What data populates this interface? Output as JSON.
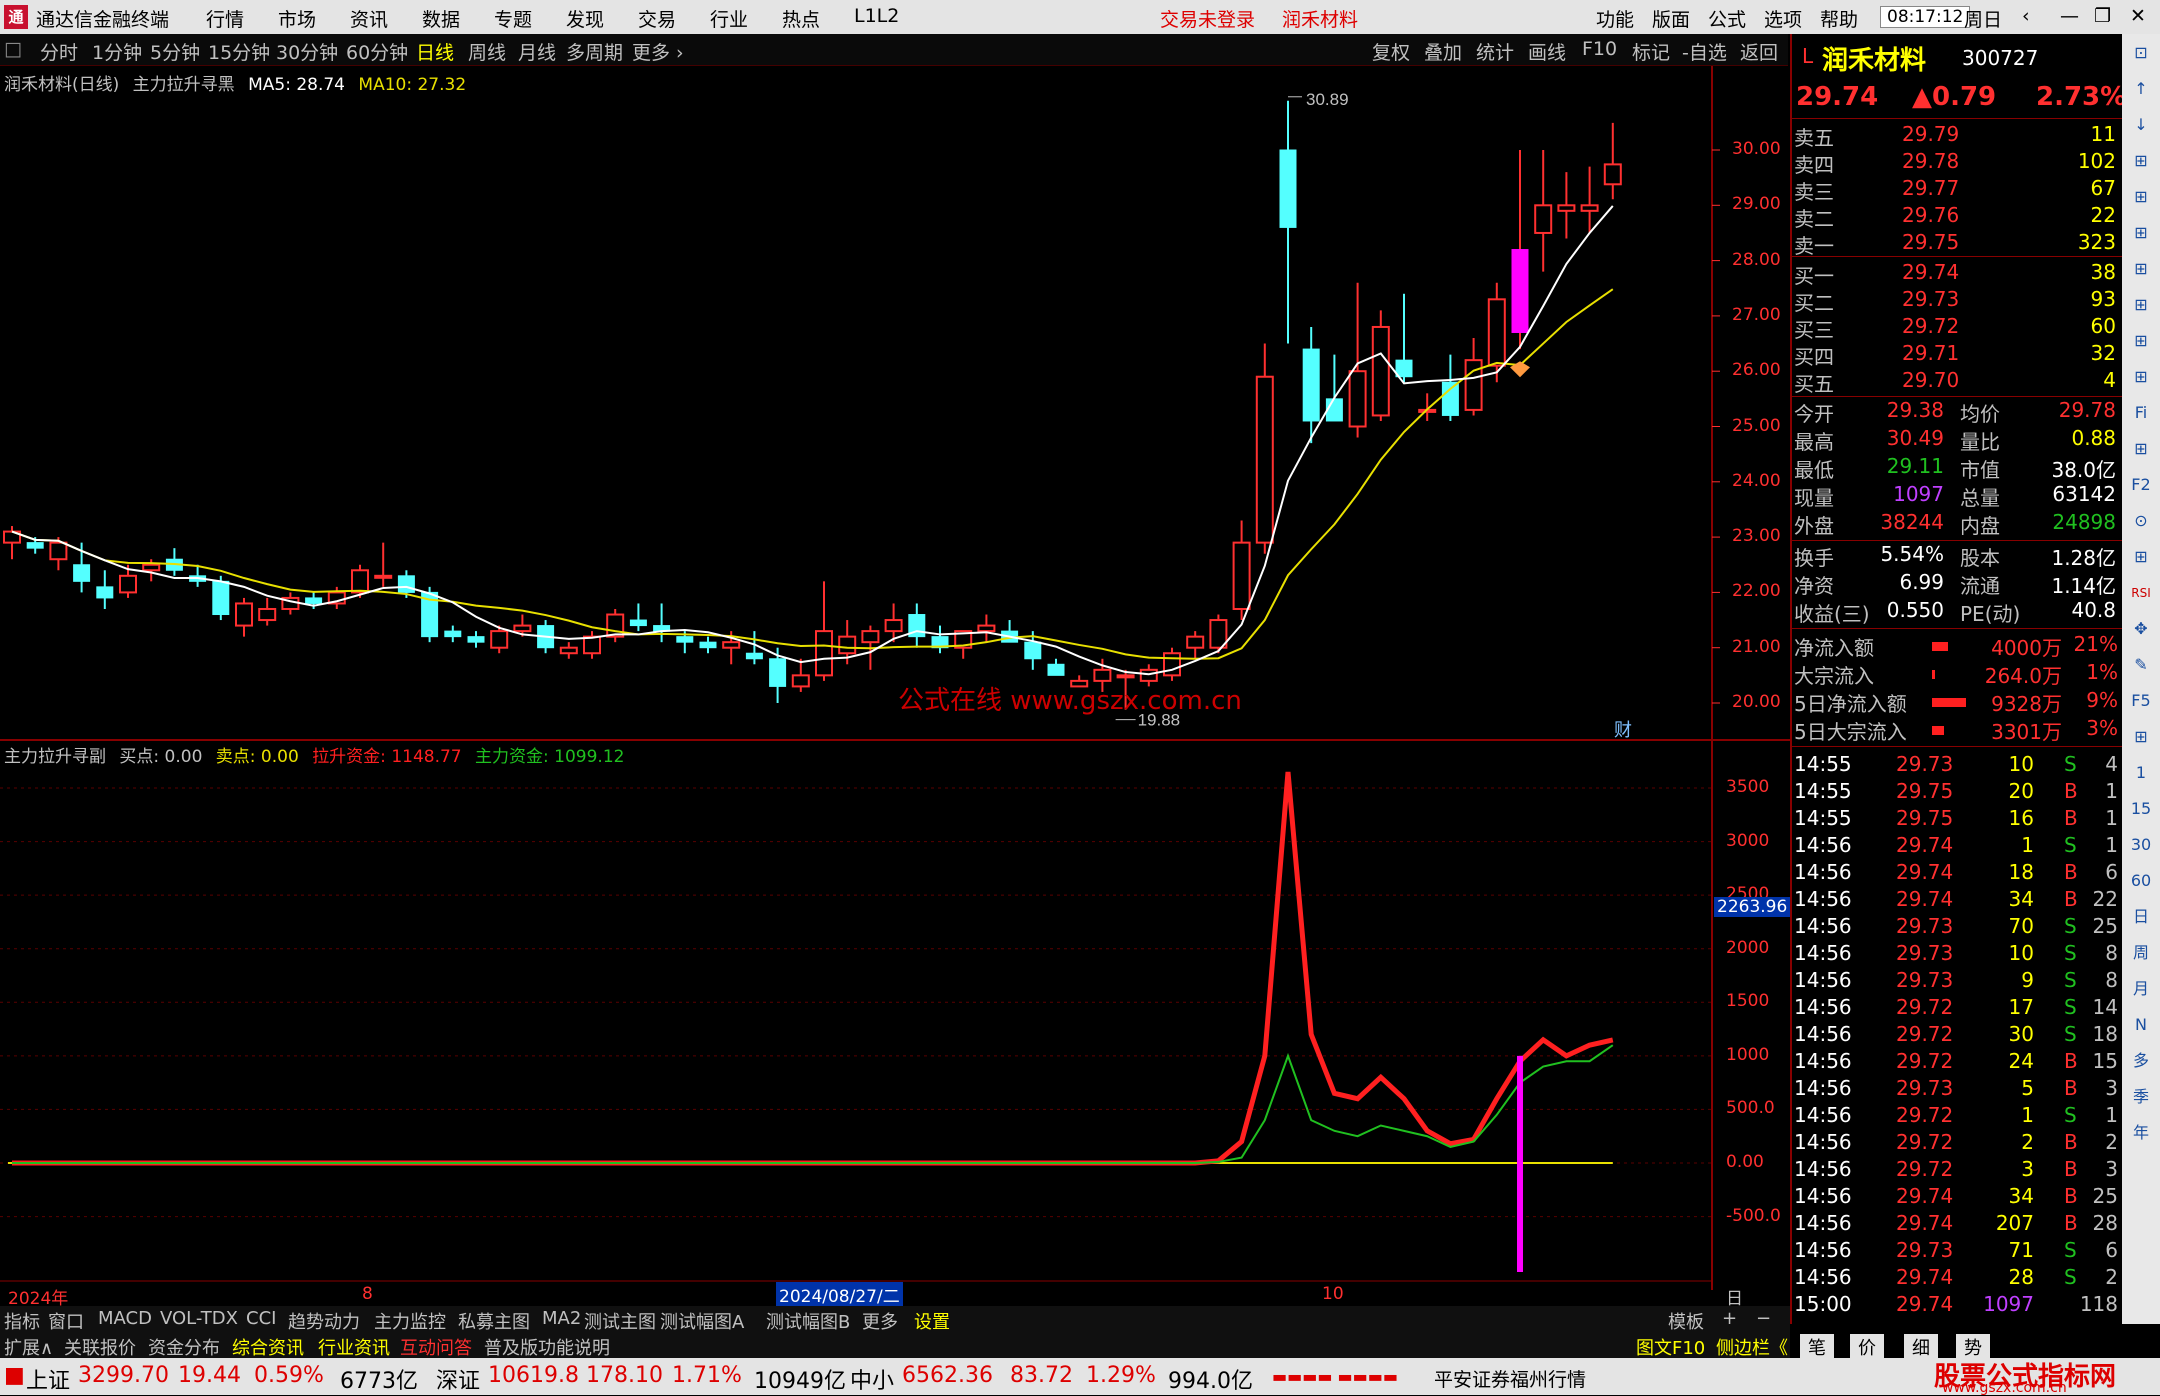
{
  "title_bar": {
    "app_name": "通达信金融终端",
    "menus": [
      "行情",
      "市场",
      "资讯",
      "数据",
      "专题",
      "发现",
      "交易",
      "行业",
      "热点",
      "L1L2"
    ],
    "trade_status": "交易未登录",
    "stock_title": "润禾材料",
    "right_menus": [
      "功能",
      "版面",
      "公式",
      "选项",
      "帮助"
    ],
    "clock": "08:17:12",
    "weekday": "周日",
    "window_icons": [
      "‹",
      "—",
      "❐",
      "✕"
    ]
  },
  "period_bar": {
    "items": [
      "分时",
      "1分钟",
      "5分钟",
      "15分钟",
      "30分钟",
      "60分钟",
      "日线",
      "周线",
      "月线",
      "多周期",
      "更多 ›"
    ],
    "active": "日线",
    "right_items": [
      "复权",
      "叠加",
      "统计",
      "画线",
      "F10",
      "标记",
      "-自选",
      "返回"
    ]
  },
  "main_chart": {
    "legend_name": "润禾材料(日线)",
    "indicator": "主力拉升寻黑",
    "ma5_label": "MA5: 28.74",
    "ma10_label": "MA10: 27.32",
    "high_label": "30.89",
    "low_label": "19.88",
    "watermark": "公式在线  www.gszx.com.cn",
    "fin_badge": "财",
    "y_ticks": [
      "30.00",
      "29.00",
      "28.00",
      "27.00",
      "26.00",
      "25.00",
      "24.00",
      "23.00",
      "22.00",
      "21.00",
      "20.00"
    ]
  },
  "sub_chart": {
    "legend_name": "主力拉升寻副",
    "buy_label": "买点: 0.00",
    "sell_label": "卖点: 0.00",
    "pull_label": "拉升资金: 1148.77",
    "main_label": "主力资金: 1099.12",
    "cursor_value": "2263.96",
    "y_ticks": [
      "3500",
      "3000",
      "2500",
      "2000",
      "1500",
      "1000",
      "500.0",
      "0.00",
      "-500.0"
    ]
  },
  "x_axis": {
    "labels": [
      "2024年",
      "8",
      "2024/08/27/二",
      "10"
    ],
    "period": "日线"
  },
  "chart_data": [
    {
      "type": "candlestick",
      "title": "润禾材料(日线)",
      "y_range": [
        19.8,
        31.0
      ],
      "series": [
        {
          "name": "K",
          "ohlc": [
            [
              22.9,
              23.2,
              22.6,
              23.1
            ],
            [
              22.9,
              23.0,
              22.7,
              22.8
            ],
            [
              22.6,
              23.0,
              22.4,
              22.9
            ],
            [
              22.5,
              22.9,
              22.0,
              22.2
            ],
            [
              22.1,
              22.4,
              21.7,
              21.9
            ],
            [
              22.0,
              22.5,
              21.9,
              22.3
            ],
            [
              22.4,
              22.6,
              22.2,
              22.5
            ],
            [
              22.6,
              22.8,
              22.3,
              22.4
            ],
            [
              22.3,
              22.5,
              22.1,
              22.2
            ],
            [
              22.2,
              22.3,
              21.5,
              21.6
            ],
            [
              21.4,
              21.9,
              21.2,
              21.8
            ],
            [
              21.5,
              21.9,
              21.4,
              21.7
            ],
            [
              21.7,
              22.0,
              21.6,
              21.9
            ],
            [
              21.9,
              22.0,
              21.7,
              21.8
            ],
            [
              21.8,
              22.1,
              21.7,
              22.0
            ],
            [
              22.0,
              22.5,
              21.9,
              22.4
            ],
            [
              22.3,
              22.9,
              22.1,
              22.3
            ],
            [
              22.3,
              22.4,
              21.9,
              22.0
            ],
            [
              22.0,
              22.1,
              21.1,
              21.2
            ],
            [
              21.3,
              21.4,
              21.1,
              21.2
            ],
            [
              21.2,
              21.3,
              21.0,
              21.1
            ],
            [
              21.0,
              21.4,
              20.9,
              21.3
            ],
            [
              21.3,
              21.6,
              21.2,
              21.4
            ],
            [
              21.4,
              21.5,
              20.9,
              21.0
            ],
            [
              20.9,
              21.1,
              20.8,
              21.0
            ],
            [
              20.9,
              21.3,
              20.8,
              21.2
            ],
            [
              21.2,
              21.7,
              21.1,
              21.6
            ],
            [
              21.5,
              21.8,
              21.3,
              21.4
            ],
            [
              21.4,
              21.8,
              21.1,
              21.3
            ],
            [
              21.2,
              21.3,
              20.9,
              21.1
            ],
            [
              21.1,
              21.2,
              20.9,
              21.0
            ],
            [
              21.0,
              21.3,
              20.7,
              21.1
            ],
            [
              20.9,
              21.3,
              20.7,
              20.8
            ],
            [
              20.8,
              21.0,
              20.0,
              20.3
            ],
            [
              20.3,
              20.8,
              20.2,
              20.5
            ],
            [
              20.5,
              22.2,
              20.4,
              21.3
            ],
            [
              20.9,
              21.5,
              20.7,
              21.2
            ],
            [
              21.1,
              21.4,
              20.6,
              21.3
            ],
            [
              21.3,
              21.8,
              21.1,
              21.5
            ],
            [
              21.6,
              21.8,
              21.0,
              21.2
            ],
            [
              21.2,
              21.4,
              20.9,
              21.0
            ],
            [
              21.0,
              21.3,
              20.8,
              21.3
            ],
            [
              21.3,
              21.6,
              21.1,
              21.4
            ],
            [
              21.3,
              21.5,
              21.1,
              21.1
            ],
            [
              21.1,
              21.3,
              20.6,
              20.8
            ],
            [
              20.7,
              20.8,
              20.5,
              20.5
            ],
            [
              20.3,
              20.5,
              20.3,
              20.4
            ],
            [
              20.4,
              20.8,
              20.2,
              20.6
            ],
            [
              20.5,
              20.6,
              19.88,
              20.5
            ],
            [
              20.4,
              20.7,
              20.3,
              20.6
            ],
            [
              20.5,
              21.0,
              20.4,
              20.9
            ],
            [
              21.0,
              21.3,
              20.8,
              21.2
            ],
            [
              21.0,
              21.6,
              20.9,
              21.5
            ],
            [
              21.7,
              23.3,
              21.5,
              22.9
            ],
            [
              22.9,
              26.5,
              22.7,
              25.9
            ],
            [
              30.0,
              30.89,
              26.5,
              28.6
            ],
            [
              26.4,
              26.8,
              24.7,
              25.1
            ],
            [
              25.5,
              26.3,
              25.1,
              25.1
            ],
            [
              25.0,
              27.6,
              24.8,
              26.0
            ],
            [
              25.2,
              27.1,
              25.1,
              26.8
            ],
            [
              26.2,
              27.4,
              25.8,
              25.9
            ],
            [
              25.3,
              25.6,
              25.1,
              25.3
            ],
            [
              25.8,
              26.3,
              25.1,
              25.2
            ],
            [
              25.3,
              26.6,
              25.2,
              26.2
            ],
            [
              26.1,
              27.6,
              25.8,
              27.3
            ],
            [
              26.7,
              30.0,
              26.4,
              28.2
            ],
            [
              28.5,
              30.0,
              27.8,
              29.0
            ],
            [
              28.9,
              29.6,
              28.4,
              29.0
            ],
            [
              28.9,
              29.7,
              28.5,
              29.0
            ],
            [
              29.38,
              30.49,
              29.11,
              29.74
            ]
          ]
        }
      ]
    },
    {
      "type": "line",
      "title": "主力拉升寻副",
      "y_range": [
        -800,
        3800
      ],
      "series": [
        {
          "name": "拉升资金",
          "color": "#ff2020",
          "values": [
            0,
            0,
            0,
            0,
            0,
            0,
            0,
            0,
            0,
            0,
            0,
            0,
            0,
            0,
            0,
            0,
            0,
            0,
            0,
            0,
            0,
            0,
            0,
            0,
            0,
            0,
            0,
            0,
            0,
            0,
            0,
            0,
            0,
            0,
            0,
            0,
            0,
            0,
            0,
            0,
            0,
            0,
            0,
            0,
            0,
            0,
            0,
            0,
            0,
            0,
            0,
            0,
            20,
            200,
            1000,
            3650,
            1200,
            650,
            600,
            800,
            600,
            300,
            180,
            220,
            600,
            950,
            1150,
            1000,
            1100,
            1148.77
          ]
        },
        {
          "name": "主力资金",
          "color": "#20c020",
          "values": [
            0,
            0,
            0,
            0,
            0,
            0,
            0,
            0,
            0,
            0,
            0,
            0,
            0,
            0,
            0,
            0,
            0,
            0,
            0,
            0,
            0,
            0,
            0,
            0,
            0,
            0,
            0,
            0,
            0,
            0,
            0,
            0,
            0,
            0,
            0,
            0,
            0,
            0,
            0,
            0,
            0,
            0,
            0,
            0,
            0,
            0,
            0,
            0,
            0,
            0,
            0,
            0,
            10,
            50,
            400,
            1000,
            400,
            300,
            250,
            350,
            300,
            250,
            150,
            200,
            450,
            750,
            900,
            950,
            950,
            1099.12
          ]
        }
      ]
    }
  ],
  "quote": {
    "name": "润禾材料",
    "code": "300727",
    "price": "29.74",
    "change": "▲0.79",
    "change_pct": "2.73%",
    "asks": [
      [
        "卖五",
        "29.79",
        "11"
      ],
      [
        "卖四",
        "29.78",
        "102"
      ],
      [
        "卖三",
        "29.77",
        "67"
      ],
      [
        "卖二",
        "29.76",
        "22"
      ],
      [
        "卖一",
        "29.75",
        "323"
      ]
    ],
    "bids": [
      [
        "买一",
        "29.74",
        "38"
      ],
      [
        "买二",
        "29.73",
        "93"
      ],
      [
        "买三",
        "29.72",
        "60"
      ],
      [
        "买四",
        "29.71",
        "32"
      ],
      [
        "买五",
        "29.70",
        "4"
      ]
    ],
    "stats": [
      [
        "今开",
        "29.38",
        "均价",
        "29.78"
      ],
      [
        "最高",
        "30.49",
        "量比",
        "0.88"
      ],
      [
        "最低",
        "29.11",
        "市值",
        "38.0亿"
      ],
      [
        "现量",
        "1097",
        "总量",
        "63142"
      ],
      [
        "外盘",
        "38244",
        "内盘",
        "24898"
      ]
    ],
    "fin": [
      [
        "换手",
        "5.54%",
        "股本",
        "1.28亿"
      ],
      [
        "净资",
        "6.99",
        "流通",
        "1.14亿"
      ],
      [
        "收益(三)",
        "0.550",
        "PE(动)",
        "40.8"
      ]
    ],
    "flows": [
      [
        "净流入额",
        "4000万",
        "21%"
      ],
      [
        "大宗流入",
        "264.0万",
        "1%"
      ],
      [
        "5日净流入额",
        "9328万",
        "9%"
      ],
      [
        "5日大宗流入",
        "3301万",
        "3%"
      ]
    ],
    "ticks": [
      [
        "14:55",
        "29.73",
        "10",
        "S",
        "4"
      ],
      [
        "14:55",
        "29.75",
        "20",
        "B",
        "1"
      ],
      [
        "14:55",
        "29.75",
        "16",
        "B",
        "1"
      ],
      [
        "14:56",
        "29.74",
        "1",
        "S",
        "1"
      ],
      [
        "14:56",
        "29.74",
        "18",
        "B",
        "6"
      ],
      [
        "14:56",
        "29.74",
        "34",
        "B",
        "22"
      ],
      [
        "14:56",
        "29.73",
        "70",
        "S",
        "25"
      ],
      [
        "14:56",
        "29.73",
        "10",
        "S",
        "8"
      ],
      [
        "14:56",
        "29.73",
        "9",
        "S",
        "8"
      ],
      [
        "14:56",
        "29.72",
        "17",
        "S",
        "14"
      ],
      [
        "14:56",
        "29.72",
        "30",
        "S",
        "18"
      ],
      [
        "14:56",
        "29.72",
        "24",
        "B",
        "15"
      ],
      [
        "14:56",
        "29.73",
        "5",
        "B",
        "3"
      ],
      [
        "14:56",
        "29.72",
        "1",
        "S",
        "1"
      ],
      [
        "14:56",
        "29.72",
        "2",
        "B",
        "2"
      ],
      [
        "14:56",
        "29.72",
        "3",
        "B",
        "3"
      ],
      [
        "14:56",
        "29.74",
        "34",
        "B",
        "25"
      ],
      [
        "14:56",
        "29.74",
        "207",
        "B",
        "28"
      ],
      [
        "14:56",
        "29.73",
        "71",
        "S",
        "6"
      ],
      [
        "14:56",
        "29.74",
        "28",
        "S",
        "2"
      ],
      [
        "15:00",
        "29.74",
        "1097",
        "",
        "118"
      ]
    ]
  },
  "right_toolbar": [
    "⊡",
    "↑",
    "↓",
    "⊞",
    "⊞",
    "⊞",
    "⊞",
    "⊞",
    "⊞",
    "⊞",
    "Fi",
    "⊞",
    "F2",
    "⊙",
    "⊞",
    "RSI",
    "✥",
    "✎",
    "F5",
    "⊞",
    "1",
    "15",
    "30",
    "60",
    "日",
    "周",
    "月",
    "N",
    "多",
    "季",
    "年"
  ],
  "bottom_tabs": [
    "指标",
    "窗口",
    "MACD",
    "VOL-TDX",
    "CCI",
    "趋势动力",
    "主力监控",
    "私募主图",
    "MA2",
    "测试主图",
    "测试幅图A",
    "测试幅图B",
    "更多",
    "设置",
    "模板",
    "+",
    "−"
  ],
  "bottom_tabs2": [
    "扩展∧",
    "关联报价",
    "资金分布",
    "综合资讯",
    "行业资讯",
    "互动问答",
    "普及版功能说明",
    "图文F10",
    "侧边栏《",
    "笔",
    "价",
    "细",
    "势"
  ],
  "status_bar": {
    "sh_label": "上证",
    "sh_val": "3299.70",
    "sh_chg": "19.44",
    "sh_pct": "0.59%",
    "sh_amt": "6773亿",
    "sz_label": "深证",
    "sz_val": "10619.8",
    "sz_chg": "178.10",
    "sz_pct": "1.71%",
    "sz_amt": "10949亿",
    "zx_label": "中小",
    "zx_val": "6562.36",
    "zx_chg": "83.72",
    "zx_pct": "1.29%",
    "zx_amt": "994.0亿",
    "broker": "平安证券福州行情",
    "brand": "股票公式指标网",
    "brand_url": "www.gszx.com.cn"
  },
  "colors": {
    "up": "#ff3030",
    "down": "#54ffff",
    "ma5": "#ffffff",
    "ma10": "#e8e000",
    "pull": "#ff2020",
    "main": "#20c020",
    "signal": "#ff00ff"
  }
}
